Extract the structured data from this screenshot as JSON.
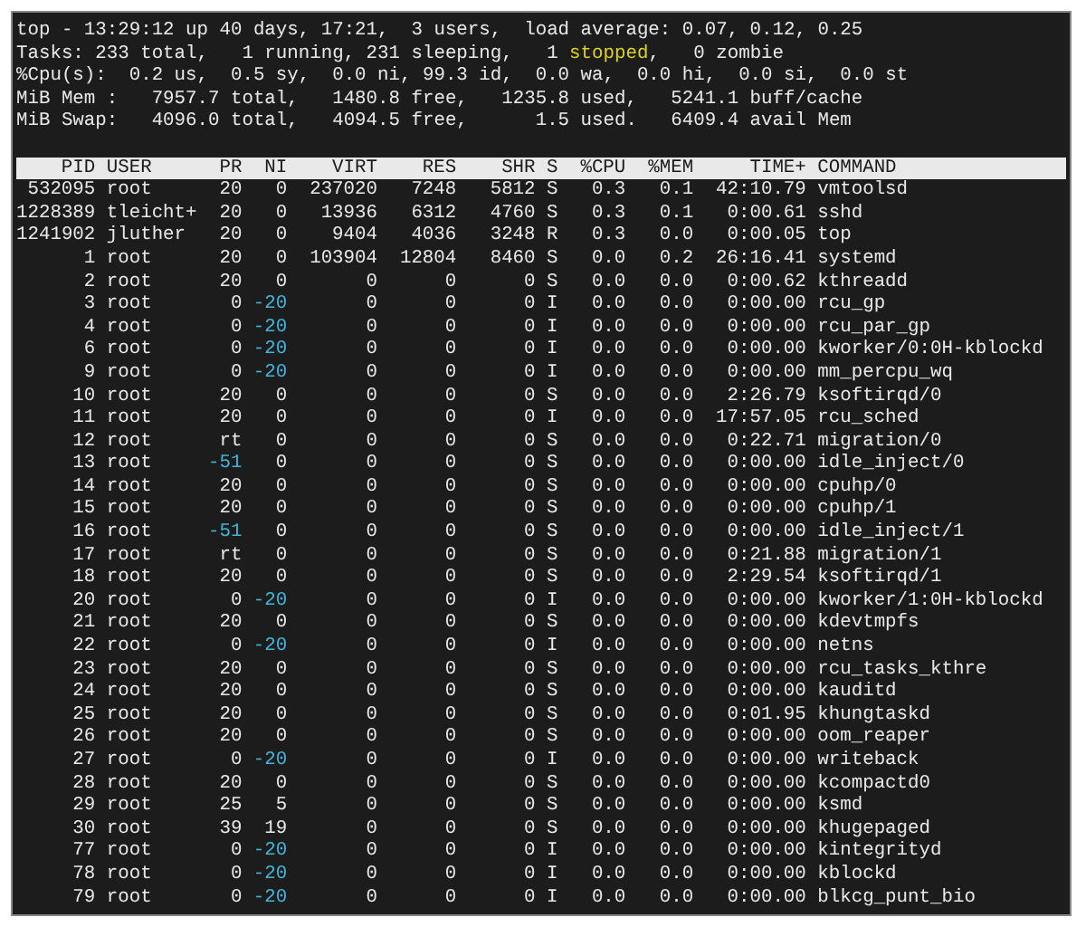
{
  "summary": [
    {
      "parts": [
        {
          "text": "top - 13:29:12 up 40 days, 17:21,  3 users,  load average: 0.07, 0.12, 0.25"
        }
      ]
    },
    {
      "parts": [
        {
          "text": "Tasks: 233 total,   1 running, 231 sleeping,   1 "
        },
        {
          "text": "stopped",
          "color": "#dcd21e"
        },
        {
          "text": ",   0 zombie"
        }
      ]
    },
    {
      "parts": [
        {
          "text": "%Cpu(s):  0.2 us,  0.5 sy,  0.0 ni, 99.3 id,  0.0 wa,  0.0 hi,  0.0 si,  0.0 st"
        }
      ]
    },
    {
      "parts": [
        {
          "text": "MiB Mem :   7957.7 total,   1480.8 free,   1235.8 used,   5241.1 buff/cache"
        }
      ]
    },
    {
      "parts": [
        {
          "text": "MiB Swap:   4096.0 total,   4094.5 free,      1.5 used.   6409.4 avail Mem"
        }
      ]
    }
  ],
  "table": {
    "columns": [
      "PID",
      "USER",
      "PR",
      "NI",
      "VIRT",
      "RES",
      "SHR",
      "S",
      "%CPU",
      "%MEM",
      "TIME+",
      "COMMAND"
    ],
    "rows": [
      {
        "pid": "532095",
        "user": "root",
        "pr": "20",
        "ni": "0",
        "virt": "237020",
        "res": "7248",
        "shr": "5812",
        "s": "S",
        "cpu": "0.3",
        "mem": "0.1",
        "time": "42:10.79",
        "command": "vmtoolsd"
      },
      {
        "pid": "1228389",
        "user": "tleicht+",
        "pr": "20",
        "ni": "0",
        "virt": "13936",
        "res": "6312",
        "shr": "4760",
        "s": "S",
        "cpu": "0.3",
        "mem": "0.1",
        "time": "0:00.61",
        "command": "sshd"
      },
      {
        "pid": "1241902",
        "user": "jluther",
        "pr": "20",
        "ni": "0",
        "virt": "9404",
        "res": "4036",
        "shr": "3248",
        "s": "R",
        "cpu": "0.3",
        "mem": "0.0",
        "time": "0:00.05",
        "command": "top"
      },
      {
        "pid": "1",
        "user": "root",
        "pr": "20",
        "ni": "0",
        "virt": "103904",
        "res": "12804",
        "shr": "8460",
        "s": "S",
        "cpu": "0.0",
        "mem": "0.2",
        "time": "26:16.41",
        "command": "systemd"
      },
      {
        "pid": "2",
        "user": "root",
        "pr": "20",
        "ni": "0",
        "virt": "0",
        "res": "0",
        "shr": "0",
        "s": "S",
        "cpu": "0.0",
        "mem": "0.0",
        "time": "0:00.62",
        "command": "kthreadd"
      },
      {
        "pid": "3",
        "user": "root",
        "pr": "0",
        "ni": {
          "text": "-20",
          "color": "#3fb5da"
        },
        "virt": "0",
        "res": "0",
        "shr": "0",
        "s": "I",
        "cpu": "0.0",
        "mem": "0.0",
        "time": "0:00.00",
        "command": "rcu_gp"
      },
      {
        "pid": "4",
        "user": "root",
        "pr": "0",
        "ni": {
          "text": "-20",
          "color": "#3fb5da"
        },
        "virt": "0",
        "res": "0",
        "shr": "0",
        "s": "I",
        "cpu": "0.0",
        "mem": "0.0",
        "time": "0:00.00",
        "command": "rcu_par_gp"
      },
      {
        "pid": "6",
        "user": "root",
        "pr": "0",
        "ni": {
          "text": "-20",
          "color": "#3fb5da"
        },
        "virt": "0",
        "res": "0",
        "shr": "0",
        "s": "I",
        "cpu": "0.0",
        "mem": "0.0",
        "time": "0:00.00",
        "command": "kworker/0:0H-kblockd"
      },
      {
        "pid": "9",
        "user": "root",
        "pr": "0",
        "ni": {
          "text": "-20",
          "color": "#3fb5da"
        },
        "virt": "0",
        "res": "0",
        "shr": "0",
        "s": "I",
        "cpu": "0.0",
        "mem": "0.0",
        "time": "0:00.00",
        "command": "mm_percpu_wq"
      },
      {
        "pid": "10",
        "user": "root",
        "pr": "20",
        "ni": "0",
        "virt": "0",
        "res": "0",
        "shr": "0",
        "s": "S",
        "cpu": "0.0",
        "mem": "0.0",
        "time": "2:26.79",
        "command": "ksoftirqd/0"
      },
      {
        "pid": "11",
        "user": "root",
        "pr": "20",
        "ni": "0",
        "virt": "0",
        "res": "0",
        "shr": "0",
        "s": "I",
        "cpu": "0.0",
        "mem": "0.0",
        "time": "17:57.05",
        "command": "rcu_sched"
      },
      {
        "pid": "12",
        "user": "root",
        "pr": "rt",
        "ni": "0",
        "virt": "0",
        "res": "0",
        "shr": "0",
        "s": "S",
        "cpu": "0.0",
        "mem": "0.0",
        "time": "0:22.71",
        "command": "migration/0"
      },
      {
        "pid": "13",
        "user": "root",
        "pr": {
          "text": "-51",
          "color": "#3fb5da"
        },
        "ni": "0",
        "virt": "0",
        "res": "0",
        "shr": "0",
        "s": "S",
        "cpu": "0.0",
        "mem": "0.0",
        "time": "0:00.00",
        "command": "idle_inject/0"
      },
      {
        "pid": "14",
        "user": "root",
        "pr": "20",
        "ni": "0",
        "virt": "0",
        "res": "0",
        "shr": "0",
        "s": "S",
        "cpu": "0.0",
        "mem": "0.0",
        "time": "0:00.00",
        "command": "cpuhp/0"
      },
      {
        "pid": "15",
        "user": "root",
        "pr": "20",
        "ni": "0",
        "virt": "0",
        "res": "0",
        "shr": "0",
        "s": "S",
        "cpu": "0.0",
        "mem": "0.0",
        "time": "0:00.00",
        "command": "cpuhp/1"
      },
      {
        "pid": "16",
        "user": "root",
        "pr": {
          "text": "-51",
          "color": "#3fb5da"
        },
        "ni": "0",
        "virt": "0",
        "res": "0",
        "shr": "0",
        "s": "S",
        "cpu": "0.0",
        "mem": "0.0",
        "time": "0:00.00",
        "command": "idle_inject/1"
      },
      {
        "pid": "17",
        "user": "root",
        "pr": "rt",
        "ni": "0",
        "virt": "0",
        "res": "0",
        "shr": "0",
        "s": "S",
        "cpu": "0.0",
        "mem": "0.0",
        "time": "0:21.88",
        "command": "migration/1"
      },
      {
        "pid": "18",
        "user": "root",
        "pr": "20",
        "ni": "0",
        "virt": "0",
        "res": "0",
        "shr": "0",
        "s": "S",
        "cpu": "0.0",
        "mem": "0.0",
        "time": "2:29.54",
        "command": "ksoftirqd/1"
      },
      {
        "pid": "20",
        "user": "root",
        "pr": "0",
        "ni": {
          "text": "-20",
          "color": "#3fb5da"
        },
        "virt": "0",
        "res": "0",
        "shr": "0",
        "s": "I",
        "cpu": "0.0",
        "mem": "0.0",
        "time": "0:00.00",
        "command": "kworker/1:0H-kblockd"
      },
      {
        "pid": "21",
        "user": "root",
        "pr": "20",
        "ni": "0",
        "virt": "0",
        "res": "0",
        "shr": "0",
        "s": "S",
        "cpu": "0.0",
        "mem": "0.0",
        "time": "0:00.00",
        "command": "kdevtmpfs"
      },
      {
        "pid": "22",
        "user": "root",
        "pr": "0",
        "ni": {
          "text": "-20",
          "color": "#3fb5da"
        },
        "virt": "0",
        "res": "0",
        "shr": "0",
        "s": "I",
        "cpu": "0.0",
        "mem": "0.0",
        "time": "0:00.00",
        "command": "netns"
      },
      {
        "pid": "23",
        "user": "root",
        "pr": "20",
        "ni": "0",
        "virt": "0",
        "res": "0",
        "shr": "0",
        "s": "S",
        "cpu": "0.0",
        "mem": "0.0",
        "time": "0:00.00",
        "command": "rcu_tasks_kthre"
      },
      {
        "pid": "24",
        "user": "root",
        "pr": "20",
        "ni": "0",
        "virt": "0",
        "res": "0",
        "shr": "0",
        "s": "S",
        "cpu": "0.0",
        "mem": "0.0",
        "time": "0:00.00",
        "command": "kauditd"
      },
      {
        "pid": "25",
        "user": "root",
        "pr": "20",
        "ni": "0",
        "virt": "0",
        "res": "0",
        "shr": "0",
        "s": "S",
        "cpu": "0.0",
        "mem": "0.0",
        "time": "0:01.95",
        "command": "khungtaskd"
      },
      {
        "pid": "26",
        "user": "root",
        "pr": "20",
        "ni": "0",
        "virt": "0",
        "res": "0",
        "shr": "0",
        "s": "S",
        "cpu": "0.0",
        "mem": "0.0",
        "time": "0:00.00",
        "command": "oom_reaper"
      },
      {
        "pid": "27",
        "user": "root",
        "pr": "0",
        "ni": {
          "text": "-20",
          "color": "#3fb5da"
        },
        "virt": "0",
        "res": "0",
        "shr": "0",
        "s": "I",
        "cpu": "0.0",
        "mem": "0.0",
        "time": "0:00.00",
        "command": "writeback"
      },
      {
        "pid": "28",
        "user": "root",
        "pr": "20",
        "ni": "0",
        "virt": "0",
        "res": "0",
        "shr": "0",
        "s": "S",
        "cpu": "0.0",
        "mem": "0.0",
        "time": "0:00.00",
        "command": "kcompactd0"
      },
      {
        "pid": "29",
        "user": "root",
        "pr": "25",
        "ni": "5",
        "virt": "0",
        "res": "0",
        "shr": "0",
        "s": "S",
        "cpu": "0.0",
        "mem": "0.0",
        "time": "0:00.00",
        "command": "ksmd"
      },
      {
        "pid": "30",
        "user": "root",
        "pr": "39",
        "ni": "19",
        "virt": "0",
        "res": "0",
        "shr": "0",
        "s": "S",
        "cpu": "0.0",
        "mem": "0.0",
        "time": "0:00.00",
        "command": "khugepaged"
      },
      {
        "pid": "77",
        "user": "root",
        "pr": "0",
        "ni": {
          "text": "-20",
          "color": "#3fb5da"
        },
        "virt": "0",
        "res": "0",
        "shr": "0",
        "s": "I",
        "cpu": "0.0",
        "mem": "0.0",
        "time": "0:00.00",
        "command": "kintegrityd"
      },
      {
        "pid": "78",
        "user": "root",
        "pr": "0",
        "ni": {
          "text": "-20",
          "color": "#3fb5da"
        },
        "virt": "0",
        "res": "0",
        "shr": "0",
        "s": "I",
        "cpu": "0.0",
        "mem": "0.0",
        "time": "0:00.00",
        "command": "kblockd"
      },
      {
        "pid": "79",
        "user": "root",
        "pr": "0",
        "ni": {
          "text": "-20",
          "color": "#3fb5da"
        },
        "virt": "0",
        "res": "0",
        "shr": "0",
        "s": "I",
        "cpu": "0.0",
        "mem": "0.0",
        "time": "0:00.00",
        "command": "blkcg_punt_bio"
      }
    ]
  }
}
